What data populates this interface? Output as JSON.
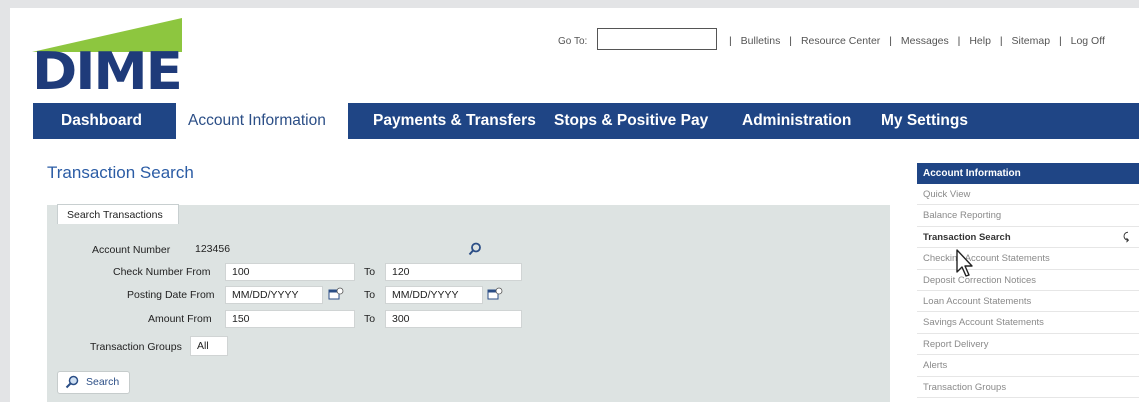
{
  "header": {
    "logo_text": "DIME",
    "goto_label": "Go To:",
    "goto_value": "",
    "top_links": [
      "Bulletins",
      "Resource Center",
      "Messages",
      "Help",
      "Sitemap",
      "Log Off"
    ]
  },
  "nav": {
    "tabs": [
      {
        "label": "Dashboard",
        "active": false
      },
      {
        "label": "Account Information",
        "active": true
      },
      {
        "label": "Payments & Transfers",
        "active": false
      },
      {
        "label": "Stops & Positive Pay",
        "active": false
      },
      {
        "label": "Administration",
        "active": false
      },
      {
        "label": "My Settings",
        "active": false
      }
    ]
  },
  "main": {
    "title": "Transaction Search",
    "form_tab": "Search Transactions",
    "account_number": {
      "label": "Account Number",
      "value": "123456"
    },
    "check_number": {
      "label": "Check Number From",
      "from": "100",
      "to_label": "To",
      "to": "120"
    },
    "posting_date": {
      "label": "Posting Date From",
      "from": "MM/DD/YYYY",
      "to_label": "To",
      "to": "MM/DD/YYYY"
    },
    "amount": {
      "label": "Amount From",
      "from": "150",
      "to_label": "To",
      "to": "300"
    },
    "transaction_groups": {
      "label": "Transaction Groups",
      "value": "All"
    },
    "search_button": "Search"
  },
  "sidebar": {
    "heading": "Account Information",
    "items": [
      {
        "label": "Quick View"
      },
      {
        "label": "Balance Reporting"
      },
      {
        "label": "Transaction Search",
        "active": true
      },
      {
        "label": "Checking Account Statements"
      },
      {
        "label": "Deposit Correction Notices"
      },
      {
        "label": "Loan Account Statements"
      },
      {
        "label": "Savings Account Statements"
      },
      {
        "label": "Report Delivery"
      },
      {
        "label": "Alerts"
      },
      {
        "label": "Transaction Groups"
      }
    ]
  },
  "colors": {
    "brand_navy": "#1f4585",
    "logo_green": "#8dc63f",
    "title_blue": "#2b5ca5"
  }
}
